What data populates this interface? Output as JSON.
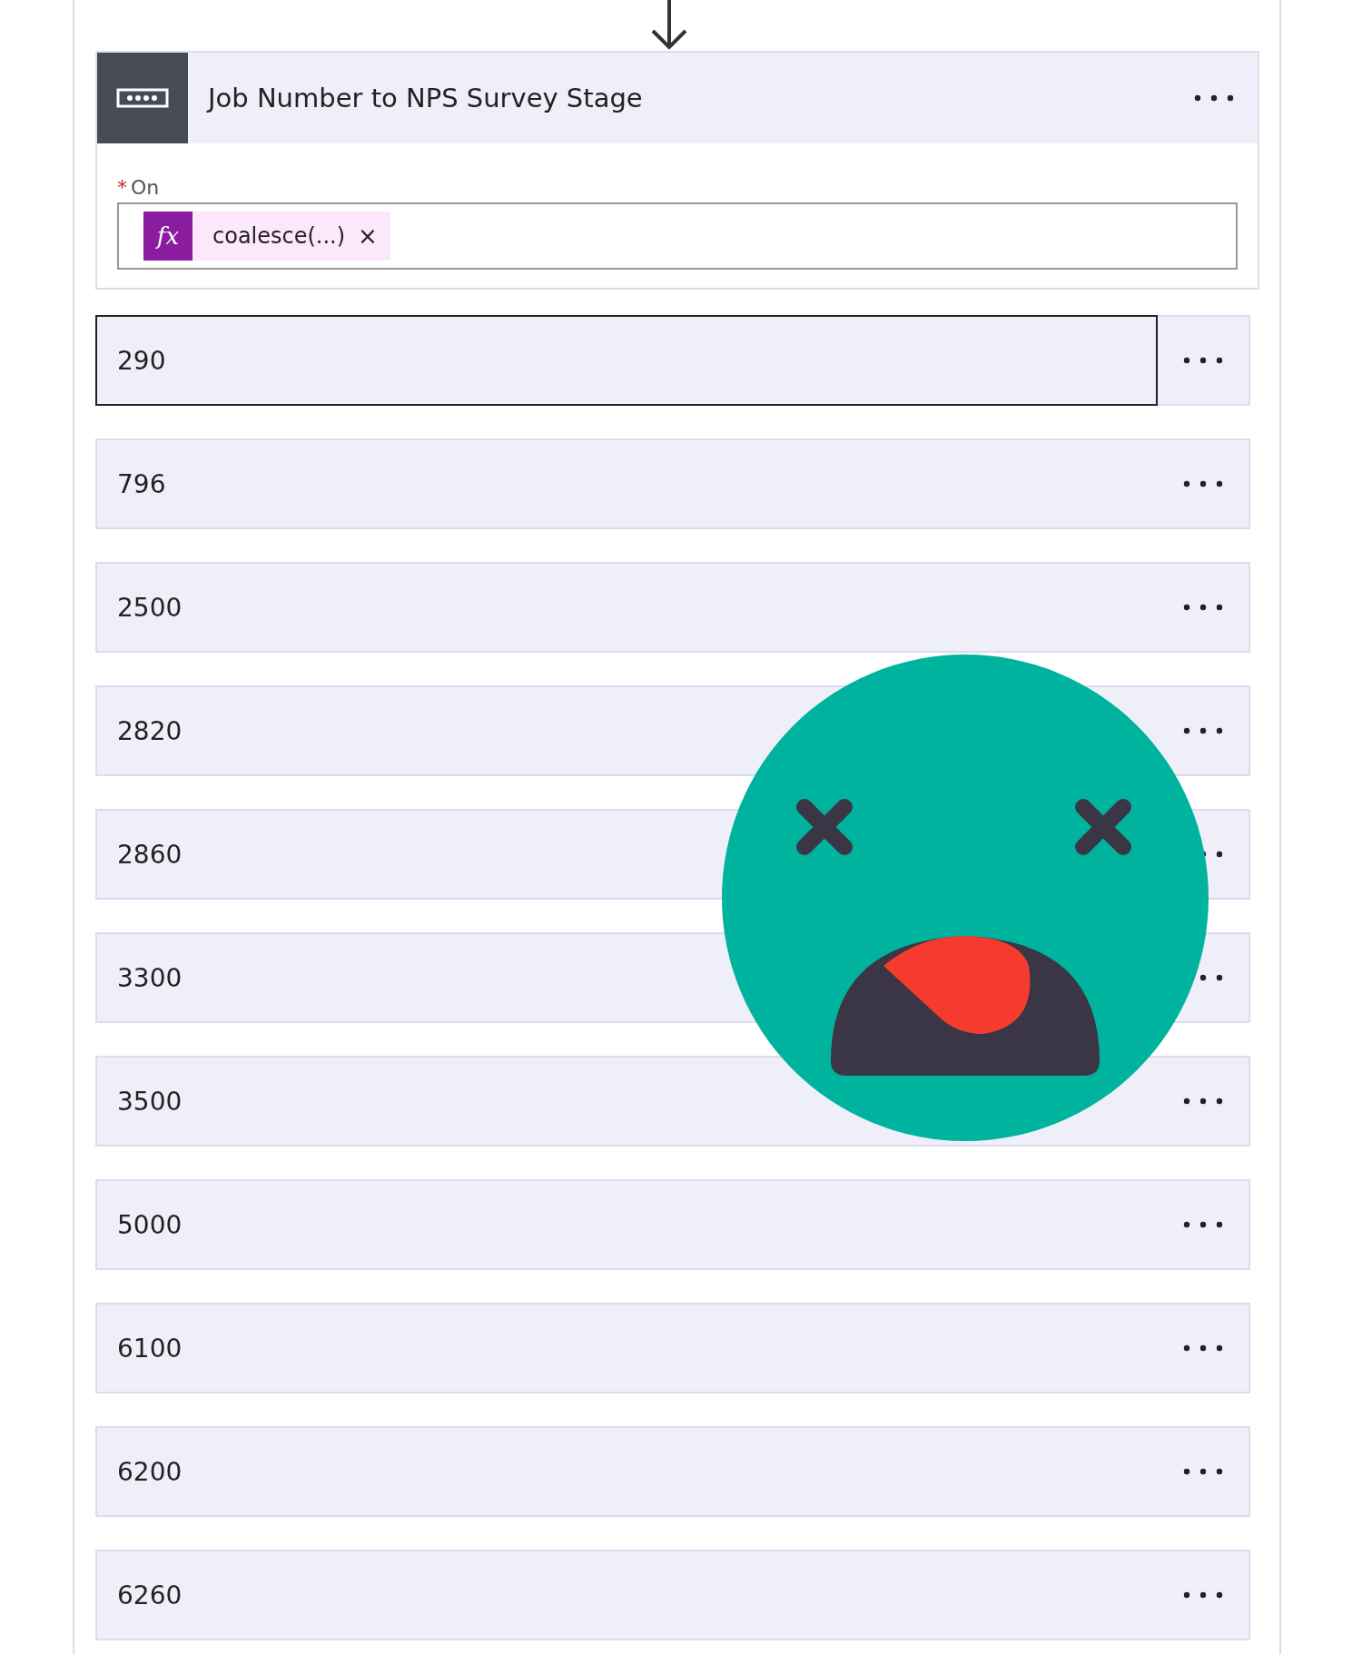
{
  "step": {
    "title": "Job Number to NPS Survey Stage"
  },
  "on": {
    "label": "On",
    "required_mark": "*",
    "token": {
      "icon_text": "fx",
      "text": "coalesce(...)",
      "remove": "×"
    }
  },
  "cases": [
    {
      "value": "290",
      "selected": true
    },
    {
      "value": "796",
      "selected": false
    },
    {
      "value": "2500",
      "selected": false
    },
    {
      "value": "2820",
      "selected": false
    },
    {
      "value": "2860",
      "selected": false
    },
    {
      "value": "3300",
      "selected": false
    },
    {
      "value": "3500",
      "selected": false
    },
    {
      "value": "5000",
      "selected": false
    },
    {
      "value": "6100",
      "selected": false
    },
    {
      "value": "6200",
      "selected": false
    },
    {
      "value": "6260",
      "selected": false
    }
  ]
}
